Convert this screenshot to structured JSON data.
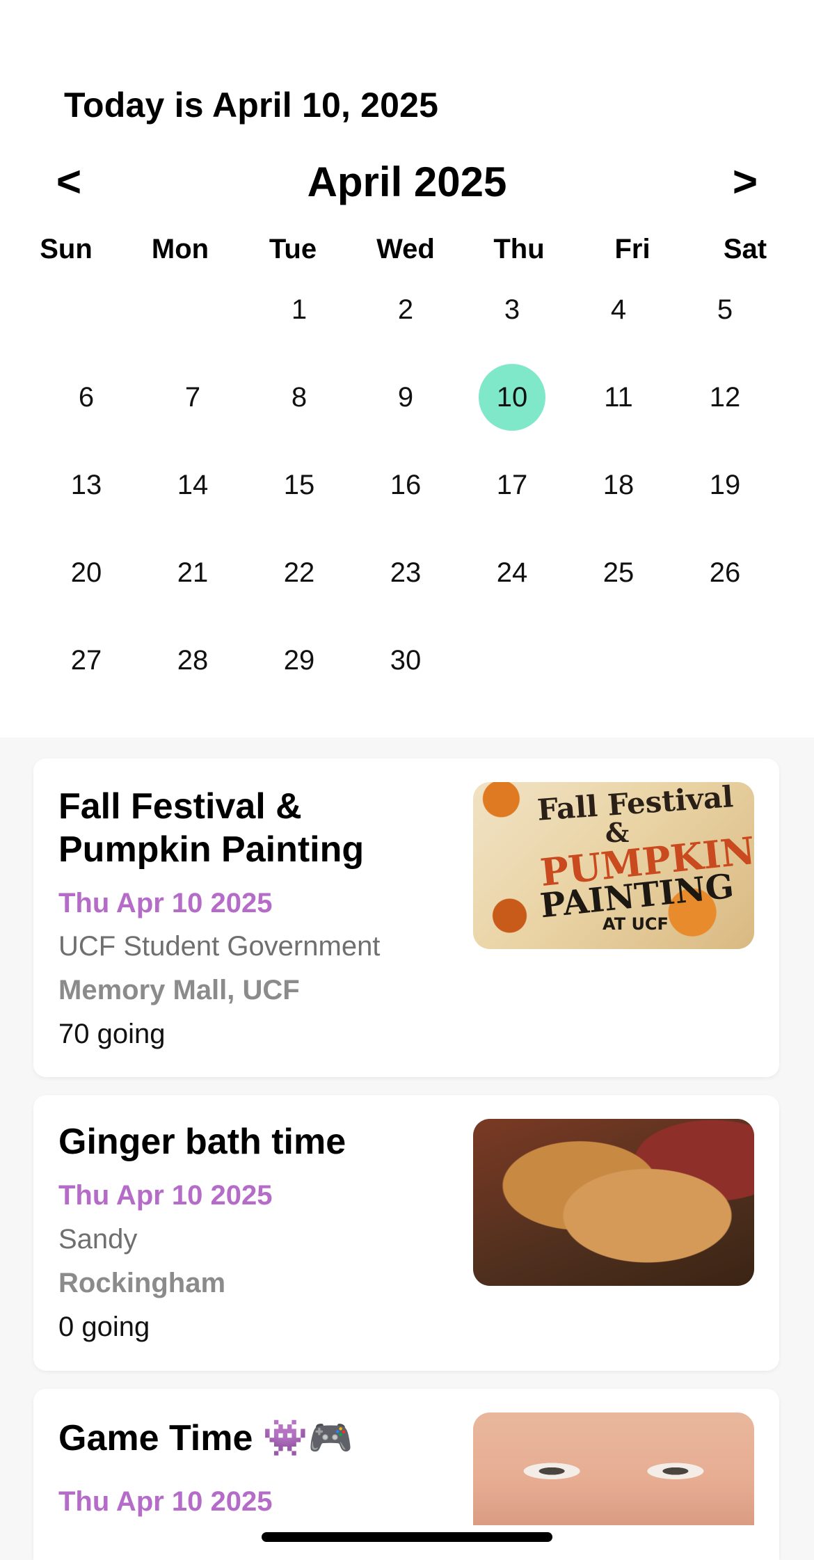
{
  "header": {
    "today_text": "Today is April 10, 2025",
    "month_title": "April 2025",
    "prev_label": "<",
    "next_label": ">"
  },
  "calendar": {
    "weekdays": [
      "Sun",
      "Mon",
      "Tue",
      "Wed",
      "Thu",
      "Fri",
      "Sat"
    ],
    "selected_day": "10",
    "selected_color": "#7ee8c8",
    "weeks": [
      [
        "",
        "",
        "1",
        "2",
        "3",
        "4",
        "5"
      ],
      [
        "6",
        "7",
        "8",
        "9",
        "10",
        "11",
        "12"
      ],
      [
        "13",
        "14",
        "15",
        "16",
        "17",
        "18",
        "19"
      ],
      [
        "20",
        "21",
        "22",
        "23",
        "24",
        "25",
        "26"
      ],
      [
        "27",
        "28",
        "29",
        "30",
        "",
        "",
        ""
      ]
    ]
  },
  "events": [
    {
      "title": "Fall Festival & Pumpkin Painting",
      "date": "Thu Apr 10 2025",
      "host": "UCF Student Government",
      "location": "Memory Mall, UCF",
      "going": "70 going",
      "image_icon": "festival-poster-image",
      "image_text": [
        "Fall Festival",
        "&",
        "PUMPKIN",
        "PAINTING",
        "AT UCF"
      ]
    },
    {
      "title": "Ginger bath time",
      "date": "Thu Apr 10 2025",
      "host": "Sandy",
      "location": "Rockingham",
      "going": "0 going",
      "image_icon": "dog-photo-image"
    },
    {
      "title": "Game Time 👾🎮",
      "date": "Thu Apr 10 2025",
      "image_icon": "face-photo-image"
    }
  ],
  "colors": {
    "date_purple": "#b56cc9",
    "host_gray": "#6f6f6f",
    "location_gray": "#8b8b8b"
  }
}
